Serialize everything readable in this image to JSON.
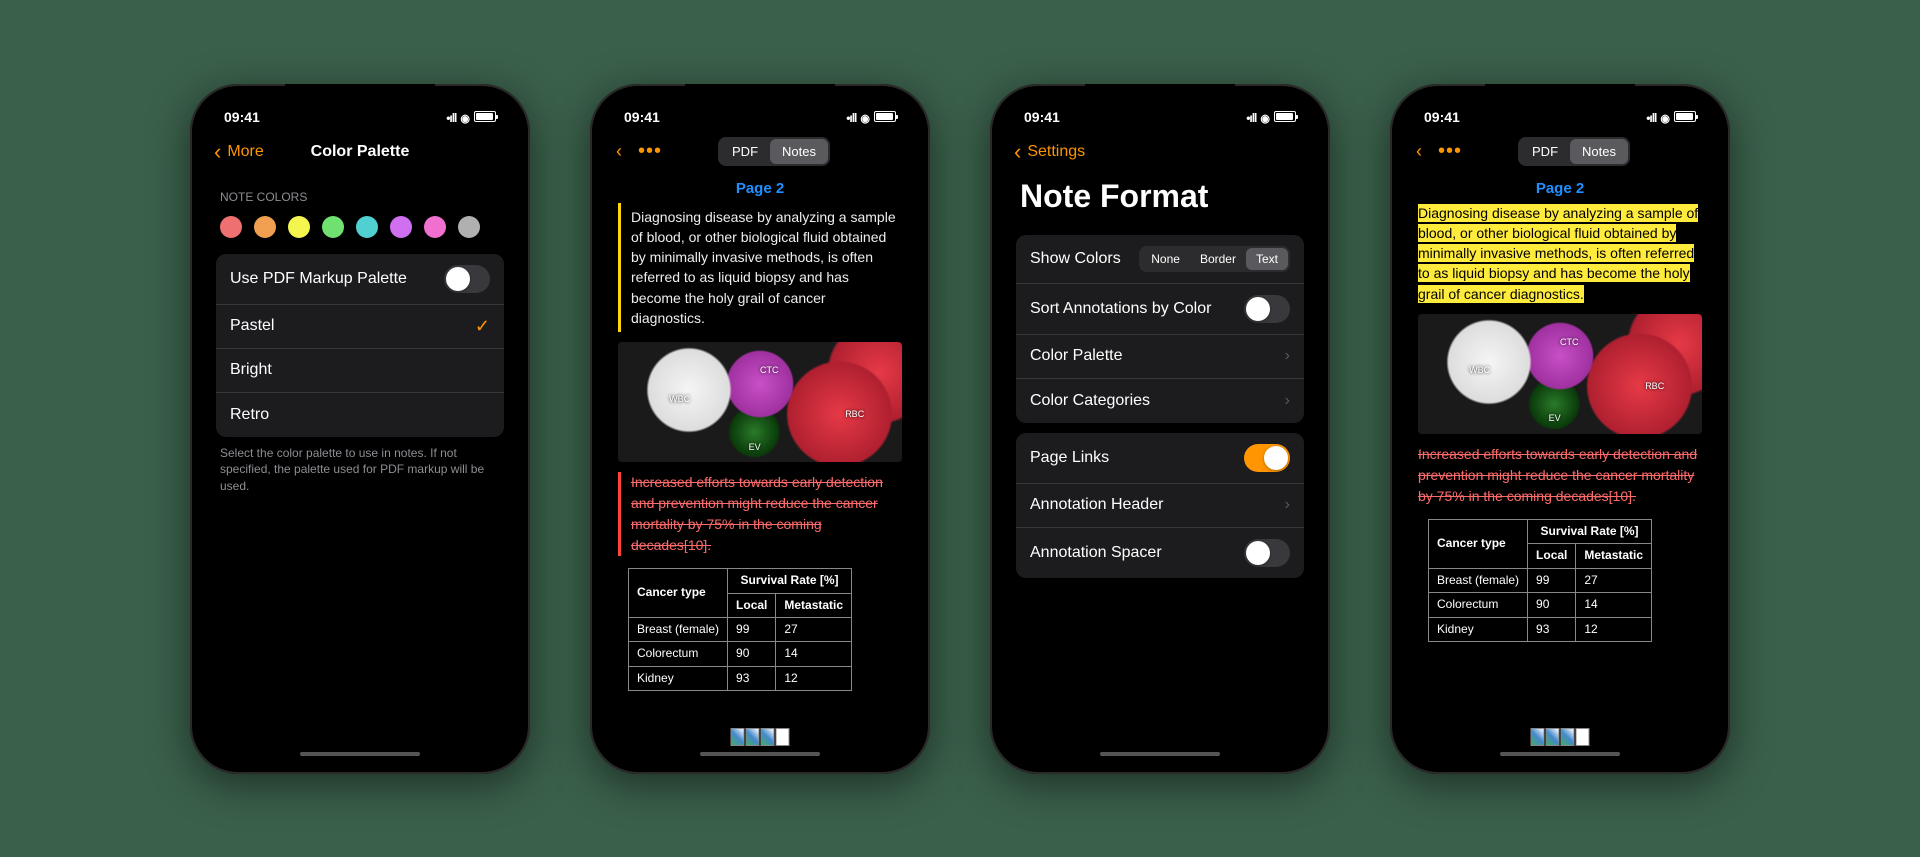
{
  "status": {
    "time": "09:41"
  },
  "phone1": {
    "back_label": "More",
    "title": "Color Palette",
    "section_header": "NOTE COLORS",
    "swatches": [
      "#ef7070",
      "#f0a050",
      "#f5f550",
      "#70e070",
      "#50d0d0",
      "#d070f0",
      "#f070d0",
      "#b0b0b0"
    ],
    "cells": {
      "use_markup": "Use PDF Markup Palette",
      "pastel": "Pastel",
      "bright": "Bright",
      "retro": "Retro"
    },
    "footer": "Select the color palette to use in notes. If not specified, the palette used for PDF markup will be used."
  },
  "notes": {
    "seg_pdf": "PDF",
    "seg_notes": "Notes",
    "page_link": "Page 2",
    "para1": "Diagnosing disease by analyzing a sample of blood, or other biological fluid obtained by minimally invasive methods, is often referred to as liquid biopsy and has become the holy grail of cancer diagnostics.",
    "img_labels": {
      "wbc": "WBC",
      "ctc": "CTC",
      "rbc": "RBC",
      "ev": "EV"
    },
    "strike": "Increased efforts towards early detection and prevention might reduce the cancer mortality by 75% in the coming decades[10].",
    "table": {
      "h1": "Cancer type",
      "h2": "Survival Rate [%]",
      "h3": "Local",
      "h4": "Metastatic",
      "rows": [
        {
          "t": "Breast (female)",
          "l": "99",
          "m": "27"
        },
        {
          "t": "Colorectum",
          "l": "90",
          "m": "14"
        },
        {
          "t": "Kidney",
          "l": "93",
          "m": "12"
        }
      ]
    }
  },
  "phone3": {
    "back_label": "Settings",
    "title": "Note Format",
    "show_colors": "Show Colors",
    "seg": {
      "none": "None",
      "border": "Border",
      "text": "Text"
    },
    "sort": "Sort Annotations by Color",
    "palette": "Color Palette",
    "categories": "Color Categories",
    "page_links": "Page Links",
    "ann_header": "Annotation Header",
    "ann_spacer": "Annotation Spacer"
  }
}
